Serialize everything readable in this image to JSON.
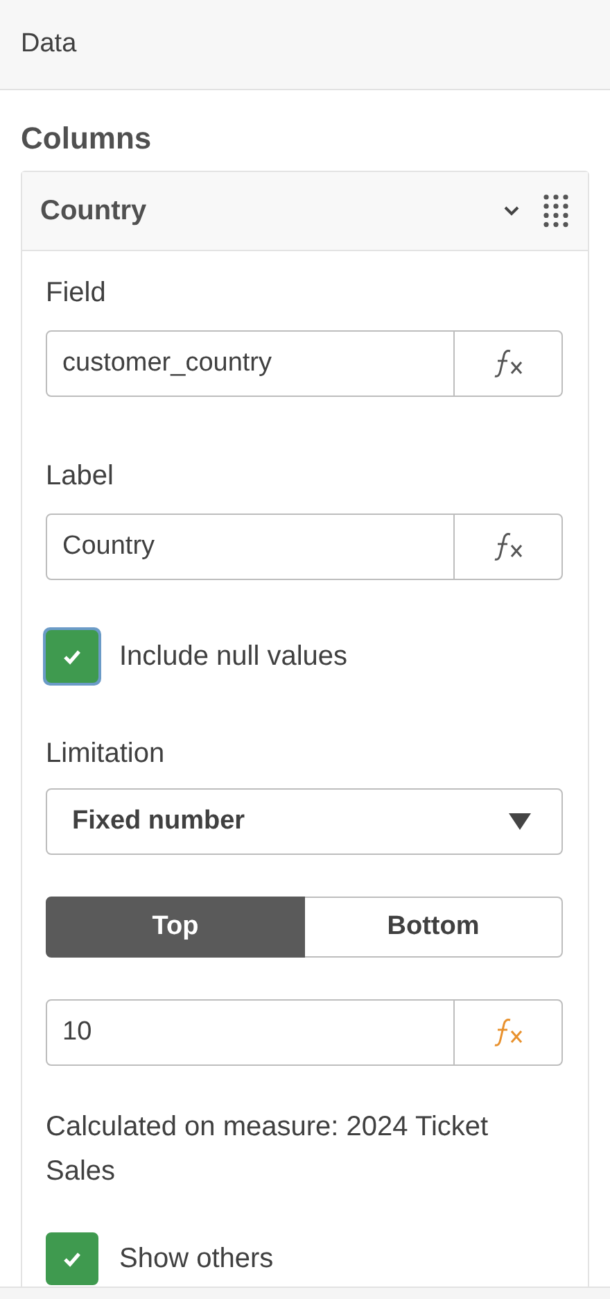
{
  "header": {
    "title": "Data"
  },
  "section": {
    "title": "Columns"
  },
  "column": {
    "title": "Country",
    "expanded": true,
    "field": {
      "label": "Field",
      "value": "customer_country",
      "expression_active": false
    },
    "label_field": {
      "label": "Label",
      "value": "Country",
      "expression_active": false
    },
    "include_null": {
      "label": "Include null values",
      "checked": true,
      "focused": true
    },
    "limitation": {
      "label": "Limitation",
      "value": "Fixed number"
    },
    "segments": [
      {
        "label": "Top",
        "selected": true
      },
      {
        "label": "Bottom",
        "selected": false
      }
    ],
    "limit_field": {
      "value": "10",
      "expression_active": true
    },
    "note": "Calculated on measure: 2024 Ticket Sales",
    "show_others": {
      "label": "Show others",
      "checked": true,
      "focused": false
    }
  }
}
